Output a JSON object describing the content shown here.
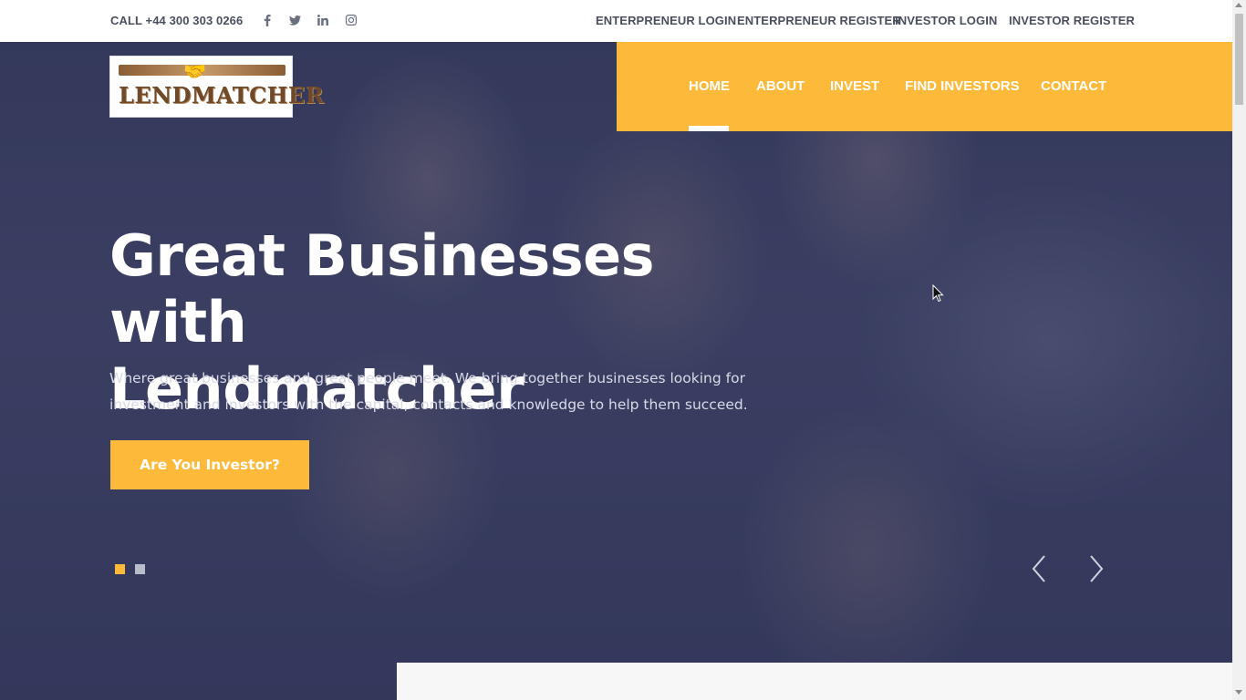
{
  "topbar": {
    "call": "CALL +44 300 303 0266",
    "social_icons": [
      "facebook-icon",
      "twitter-icon",
      "linkedin-icon",
      "instagram-icon"
    ],
    "links": [
      "ENTERPRENEUR LOGIN",
      "ENTERPRENEUR REGISTER",
      "INVESTOR LOGIN",
      "INVESTOR REGISTER"
    ]
  },
  "logo": {
    "text": "LENDMATCHER"
  },
  "nav": {
    "items": [
      "HOME",
      "ABOUT",
      "INVEST",
      "FIND INVESTORS",
      "CONTACT"
    ],
    "active": "HOME"
  },
  "hero": {
    "headline_line1": "Great Businesses with",
    "headline_line2": "Lendmatcher",
    "subtext_line1": "Where great businesses and great people meet. We bring together businesses looking for",
    "subtext_line2": "investment and investors with the capital, contacts and knowledge to help them succeed.",
    "cta_label": "Are You Investor?",
    "slides_total": 2,
    "slide_active": 1
  },
  "colors": {
    "accent": "#fdb93a",
    "text_dark": "#4a4f5e",
    "hero_overlay": "#3f4466"
  }
}
